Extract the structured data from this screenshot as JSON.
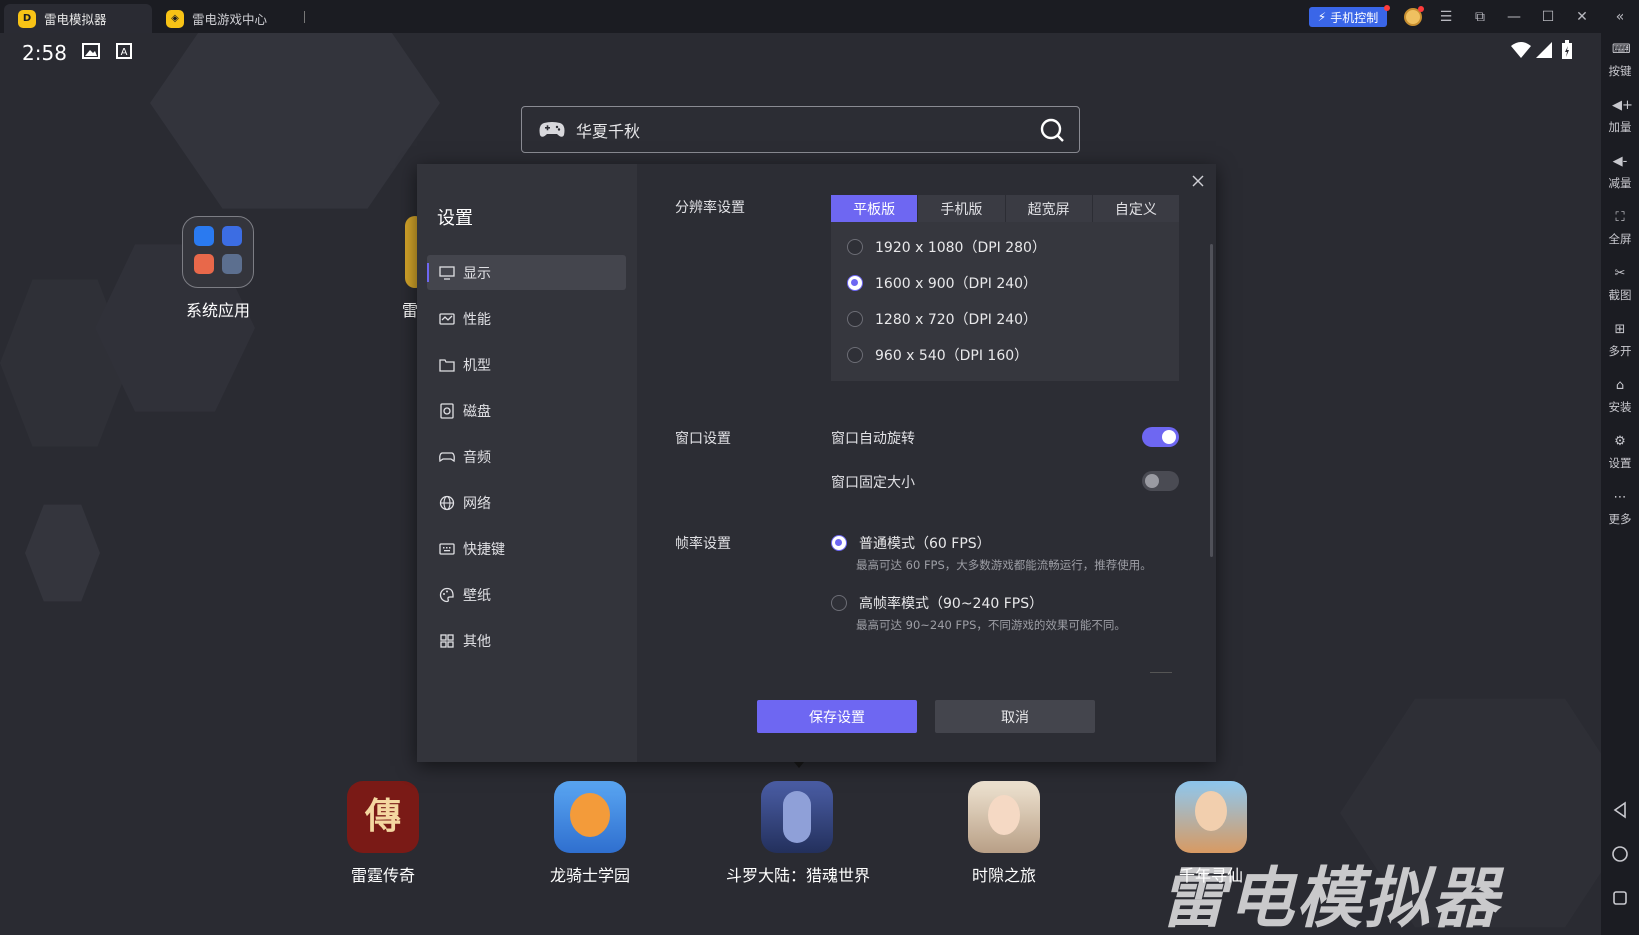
{
  "titlebar": {
    "tabs": [
      {
        "label": "雷电模拟器",
        "active": true
      },
      {
        "label": "雷电游戏中心",
        "active": false
      }
    ],
    "phone_control": "手机控制"
  },
  "status_bar": {
    "time": "2:58"
  },
  "search": {
    "text": "华夏千秋"
  },
  "home": {
    "folders": [
      {
        "label": "系统应用"
      },
      {
        "label": "雷"
      }
    ],
    "dock": [
      {
        "label": "雷霆传奇",
        "color": "#7a1a16"
      },
      {
        "label": "龙骑士学园",
        "color": "#3f7fd9"
      },
      {
        "label": "斗罗大陆：猎魂世界",
        "color": "#3b4d8f"
      },
      {
        "label": "时隙之旅",
        "color": "#d9c8b2"
      },
      {
        "label": "千年寻仙",
        "color": "#c98f5e"
      }
    ]
  },
  "dialog": {
    "title": "设置",
    "menu": [
      {
        "label": "显示",
        "icon": "monitor-icon",
        "active": true
      },
      {
        "label": "性能",
        "icon": "performance-icon"
      },
      {
        "label": "机型",
        "icon": "folder-icon"
      },
      {
        "label": "磁盘",
        "icon": "disk-icon"
      },
      {
        "label": "音频",
        "icon": "gamepad-icon"
      },
      {
        "label": "网络",
        "icon": "globe-icon"
      },
      {
        "label": "快捷键",
        "icon": "keyboard-icon"
      },
      {
        "label": "壁纸",
        "icon": "palette-icon"
      },
      {
        "label": "其他",
        "icon": "grid-icon"
      }
    ],
    "resolution": {
      "label": "分辨率设置",
      "tabs": [
        "平板版",
        "手机版",
        "超宽屏",
        "自定义"
      ],
      "active_tab": "平板版",
      "options": [
        {
          "label": "1920 x 1080（DPI 280）",
          "selected": false
        },
        {
          "label": "1600 x 900（DPI 240）",
          "selected": true
        },
        {
          "label": "1280 x 720（DPI 240）",
          "selected": false
        },
        {
          "label": "960 x 540（DPI 160）",
          "selected": false
        }
      ]
    },
    "window": {
      "label": "窗口设置",
      "auto_rotate": {
        "label": "窗口自动旋转",
        "on": true
      },
      "fixed_size": {
        "label": "窗口固定大小",
        "on": false
      }
    },
    "framerate": {
      "label": "帧率设置",
      "options": [
        {
          "label": "普通模式（60 FPS）",
          "hint": "最高可达 60 FPS，大多数游戏都能流畅运行，推荐使用。",
          "selected": true
        },
        {
          "label": "高帧率模式（90~240 FPS）",
          "hint": "最高可达 90~240 FPS，不同游戏的效果可能不同。",
          "selected": false
        }
      ]
    },
    "save": "保存设置",
    "cancel": "取消"
  },
  "right_toolbar": [
    {
      "label": "按键",
      "icon": "keymap-icon"
    },
    {
      "label": "加量",
      "icon": "volume-up-icon"
    },
    {
      "label": "减量",
      "icon": "volume-down-icon"
    },
    {
      "label": "全屏",
      "icon": "fullscreen-icon"
    },
    {
      "label": "截图",
      "icon": "scissors-icon"
    },
    {
      "label": "多开",
      "icon": "multi-instance-icon"
    },
    {
      "label": "安装",
      "icon": "apk-icon"
    },
    {
      "label": "设置",
      "icon": "settings-icon"
    },
    {
      "label": "更多",
      "icon": "more-icon"
    }
  ],
  "watermark": "雷电模拟器",
  "colors": {
    "accent": "#6e67f2",
    "background": "#2a2b32",
    "panel": "#2c2d34",
    "phone_control": "#3a66e8"
  }
}
